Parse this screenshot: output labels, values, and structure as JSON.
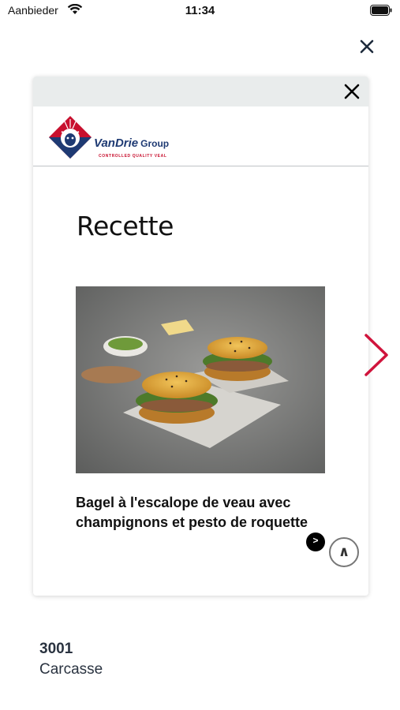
{
  "status_bar": {
    "carrier": "Aanbieder",
    "time": "11:34"
  },
  "ad": {
    "brand_name": "VanDrie",
    "brand_group": "Group",
    "brand_tagline": "CONTROLLED QUALITY VEAL",
    "heading": "Recette",
    "recipe_title": "Bagel à l'escalope de veau avec champignons et pesto de roquette",
    "ad_choice_label": ">",
    "scroll_up_label": "∧"
  },
  "product": {
    "code": "3001",
    "name": "Carcasse"
  },
  "colors": {
    "brand_blue": "#1e3a73",
    "brand_red": "#c8102e",
    "next_arrow": "#d0143c"
  },
  "icons": [
    "wifi-icon",
    "battery-icon",
    "close-icon",
    "chevron-right-icon",
    "chevron-up-icon"
  ]
}
